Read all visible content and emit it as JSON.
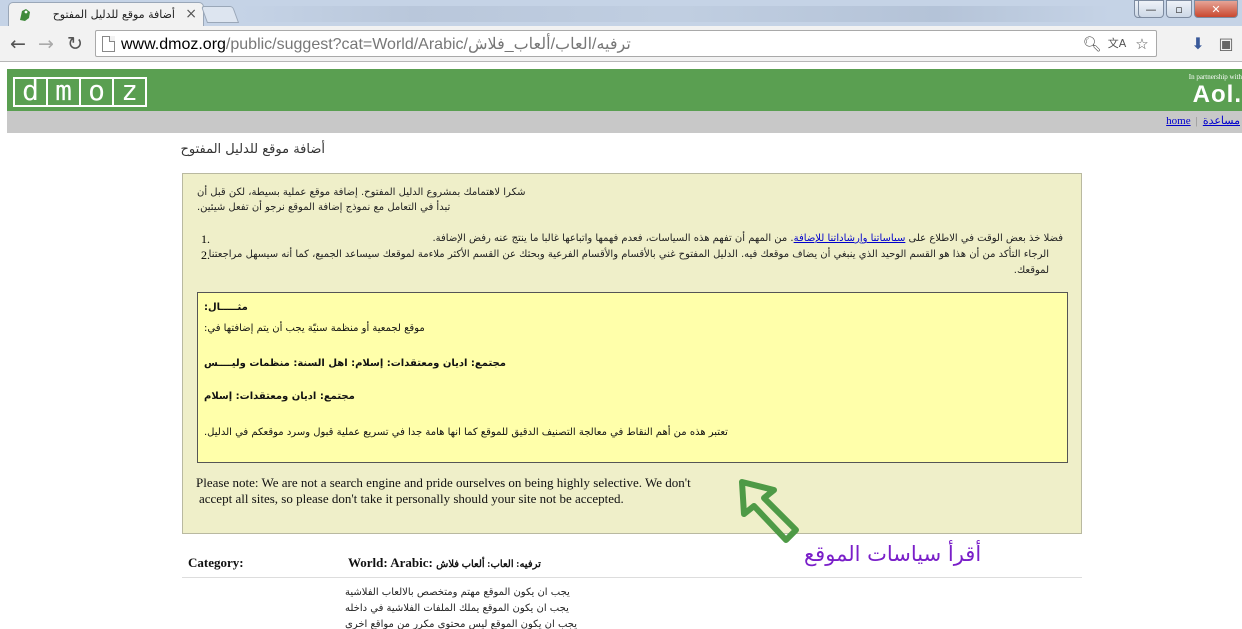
{
  "browser": {
    "tab_title": "أضافة موقع للدليل المفتوح",
    "tab_close": "×",
    "win_minimize": "—",
    "win_maximize": "▫",
    "win_close": "✕",
    "url_host": "www.dmoz.org",
    "url_rest": "/public/suggest?cat=World/Arabic/ترفيه/العاب/ألعاب_فلاش",
    "icons": [
      "back-icon",
      "forward-icon",
      "reload-icon",
      "page-icon",
      "search-icon",
      "translate-icon",
      "star-icon",
      "extension-icon",
      "puzzle-icon",
      "menu-icon"
    ]
  },
  "site": {
    "logo_letters": [
      "d",
      "m",
      "o",
      "z"
    ],
    "partner_text": "In partnership with",
    "partner_logo": "Aol.",
    "link_home": "home",
    "link_help": "مساعدة",
    "link_sep": "|"
  },
  "page": {
    "title": "أضافة موقع للدليل المفتوح",
    "intro_1": "شكرا لاهتمامك بمشروع الدليل المفتوح. إضافة موقع عملية بسيطة، لكن قبل أن",
    "intro_2": "تبدأ في التعامل مع نموذج إضافة الموقع نرجو أن تفعل شيئين.",
    "item1_num": "1.",
    "item1_pre": "فضلا خذ بعض الوقت في الاطلاع على ",
    "item1_link": "سياساتنا وإرشاداتنا للإضافة",
    "item1_post": ". من المهم أن تفهم هذه السياسات، فعدم فهمها واتباعها غالبا ما ينتج عنه رفض الإضافة.",
    "item2_num": "2.",
    "item2_line1": "الرجاء التأكد من أن هذا هو القسم الوحيد الذي ينبغي أن يضاف موقعك فيه. الدليل المفتوح غني بالأقسام والأقسام الفرعية وبحثك عن القسم الأكثر ملاءمة لموقعك سيساعد الجميع، كما أنه سيسهل مراجعتنا",
    "item2_line2": "لموقعك.",
    "example_title": "مثـــــال:",
    "example_desc": "موقع لجمعية أو منظمة سنيّة يجب أن يتم إضافتها في:",
    "example_path1": "مجتمع: اديان ومعتقدات: إسلام: اهل السنة: منظمات وليــــس",
    "example_path2": "مجتمع: اديان ومعتقدات: إسلام",
    "example_note": "تعتبر هذه من أهم النقاط في معالجة التصنيف الدقيق للموقع كما انها هامة جدا في تسريع عملية قبول وسرد موقعكم في الدليل.",
    "note_line1": "Please note: We are not a search engine and pride ourselves on being highly selective. We don't",
    "note_line2": "accept all sites, so please don't take it personally should your site not be accepted.",
    "category_label": "Category:",
    "category_prefix": "World: Arabic: ",
    "category_ar": "ترفيه: العاب: ألعاب فلاش",
    "req_1": "يجب ان يكون الموقع مهتم ومتخصص بالالعاب الفلاشية",
    "req_2": "يجب ان يكون الموقع يملك الملفات الفلاشية في داخله",
    "req_3": "يجب ان يكون الموقع ليس محتوى مكرر من مواقع اخرى"
  },
  "annotation": {
    "text": "أقرأ سياسات الموقع",
    "color": "#7a1fc9",
    "arrow_color": "#4e9a46"
  }
}
